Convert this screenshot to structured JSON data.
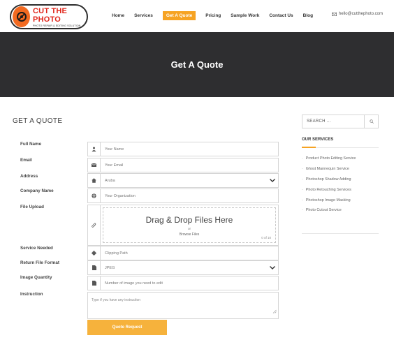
{
  "header": {
    "logo_title": "CUT THE PHOTO",
    "logo_subtitle": "PHOTO REPAIR & EDITING SOLUTION",
    "email": "hello@cutthephoto.com",
    "nav": [
      "Home",
      "Services",
      "Get A Quote",
      "Pricing",
      "Sample Work",
      "Contact Us",
      "Blog"
    ],
    "active_nav": "Get A Quote"
  },
  "banner": {
    "title": "Get A Quote"
  },
  "section_title": "GET A QUOTE",
  "labels": {
    "full_name": "Full Name",
    "email": "Email",
    "address": "Address",
    "company": "Company Name",
    "file_upload": "File Upload",
    "service": "Service Needed",
    "return_format": "Return File Format",
    "quantity": "Image Quantity",
    "instruction": "Instruction"
  },
  "form": {
    "name_placeholder": "Your Name",
    "email_placeholder": "Your Email",
    "country_value": "Aruba",
    "org_placeholder": "Your Organization",
    "dropzone_title": "Drag & Drop Files Here",
    "dropzone_or": "or",
    "dropzone_browse": "Browse Files",
    "dropzone_count": "0 of 10",
    "service_value": "Clipping Path",
    "format_value": "JPEG",
    "quantity_placeholder": "Number of image you need to edit",
    "instruction_placeholder": "Type if you have any instruction",
    "submit_label": "Quote Request"
  },
  "sidebar": {
    "search_placeholder": "SEARCH ...",
    "services_title": "OUR SERVICES",
    "services": [
      "Product Photo Editing Service",
      "Ghost Mannequin Service",
      "Photoshop Shadow Adding",
      "Photo Retouching Services",
      "Photoshop Image Masking",
      "Photo Cutout Service"
    ]
  },
  "colors": {
    "accent": "#f6a323",
    "banner_bg": "#2e2e30",
    "submit_bg": "#f6b23c"
  }
}
